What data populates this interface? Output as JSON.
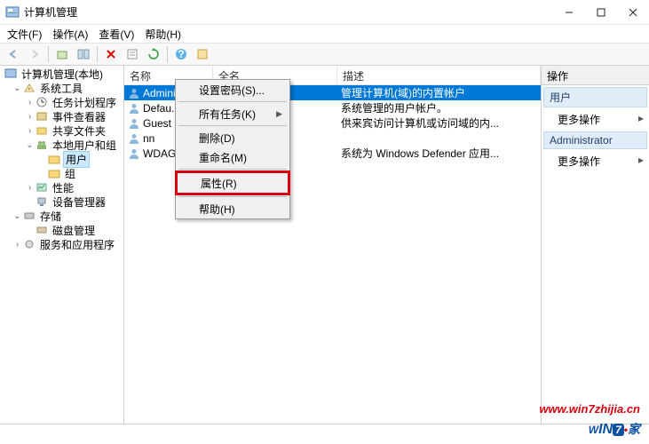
{
  "window": {
    "title": "计算机管理"
  },
  "menu": {
    "file": "文件(F)",
    "action": "操作(A)",
    "view": "查看(V)",
    "help": "帮助(H)"
  },
  "tree": {
    "root": "计算机管理(本地)",
    "system_tools": "系统工具",
    "task_scheduler": "任务计划程序",
    "event_viewer": "事件查看器",
    "shared_folders": "共享文件夹",
    "local_users": "本地用户和组",
    "users": "用户",
    "groups": "组",
    "performance": "性能",
    "device_manager": "设备管理器",
    "storage": "存储",
    "disk_management": "磁盘管理",
    "services_apps": "服务和应用程序"
  },
  "list": {
    "col_name": "名称",
    "col_fullname": "全名",
    "col_desc": "描述",
    "rows": [
      {
        "name": "Administrator",
        "full": "",
        "desc": "管理计算机(域)的内置帐户"
      },
      {
        "name": "Defau...",
        "full": "",
        "desc": "系统管理的用户帐户。"
      },
      {
        "name": "Guest",
        "full": "",
        "desc": "供来宾访问计算机或访问域的内..."
      },
      {
        "name": "nn",
        "full": "",
        "desc": ""
      },
      {
        "name": "WDAG...",
        "full": "",
        "desc": "系统为 Windows Defender 应用..."
      }
    ]
  },
  "context": {
    "set_password": "设置密码(S)...",
    "all_tasks": "所有任务(K)",
    "delete": "删除(D)",
    "rename": "重命名(M)",
    "properties": "属性(R)",
    "help": "帮助(H)"
  },
  "actions": {
    "header": "操作",
    "users": "用户",
    "more": "更多操作",
    "admin": "Administrator"
  },
  "watermark": {
    "url": "www.win7zhijia.cn",
    "brand_w": "W",
    "brand_in": "IN",
    "brand_7": "7",
    "brand_end": "家"
  }
}
